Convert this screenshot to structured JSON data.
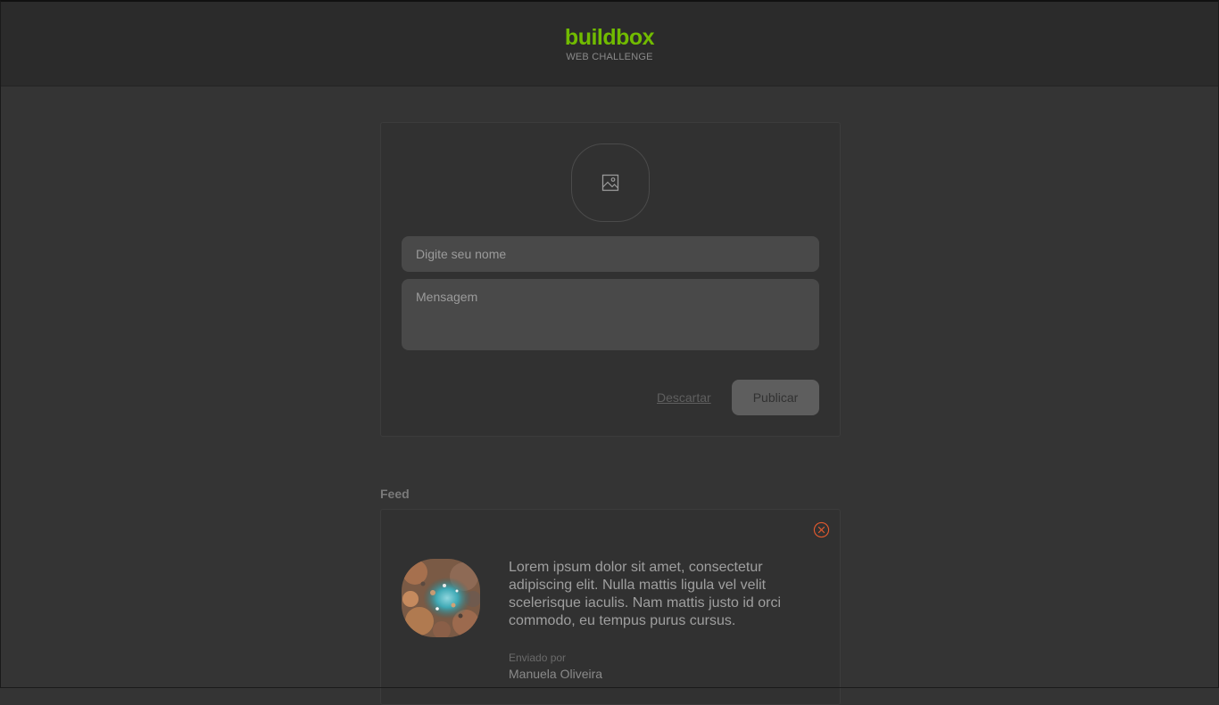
{
  "header": {
    "logo": "buildbox",
    "subtitle": "WEB CHALLENGE"
  },
  "composer": {
    "upload_icon": "image-icon",
    "name_placeholder": "Digite seu nome",
    "message_placeholder": "Mensagem",
    "discard_label": "Descartar",
    "publish_label": "Publicar"
  },
  "feed": {
    "title": "Feed",
    "posts": [
      {
        "text": "Lorem ipsum dolor sit amet, consectetur adipiscing elit. Nulla mattis ligula vel velit scelerisque iaculis. Nam mattis justo id orci commodo, eu tempus purus cursus.",
        "sent_by_label": "Enviado por",
        "author": "Manuela Oliveira",
        "delete_icon": "close-circle-icon",
        "image": "aerial-landscape-photo"
      }
    ]
  },
  "colors": {
    "accent": "#71bb00",
    "background": "#343434",
    "header_bg": "#2b2b2b",
    "delete": "#e0592f"
  }
}
